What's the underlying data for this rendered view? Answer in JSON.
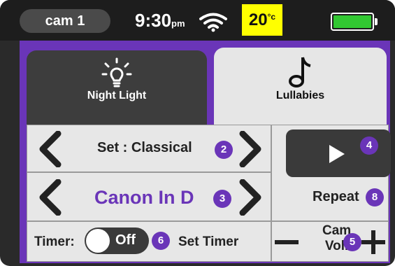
{
  "status_bar": {
    "camera": "cam 1",
    "time": "9:30",
    "time_suffix": "pm",
    "temperature": "20",
    "temperature_unit": "°c",
    "temperature_bg": "#ffff00",
    "battery_color": "#32c832",
    "battery_level": 1.0
  },
  "tabs": [
    {
      "label": "Night Light",
      "icon": "bulb-icon",
      "active": true
    },
    {
      "label": "Lullabies",
      "icon": "music-note-icon",
      "active": false
    }
  ],
  "lullabies": {
    "set_label": "Set : Classical",
    "song_title": "Canon In D",
    "repeat_label": "Repeat",
    "timer_label": "Timer:",
    "timer_state": "Off",
    "set_timer_label": "Set Timer",
    "cam_vol_line1": "Cam",
    "cam_vol_line2": "Vol."
  },
  "badges": {
    "set": "2",
    "song": "3",
    "play": "4",
    "volume": "5",
    "timer": "6",
    "repeat": "8"
  },
  "colors": {
    "accent": "#6a35b8",
    "dark": "#3a3a3a"
  }
}
